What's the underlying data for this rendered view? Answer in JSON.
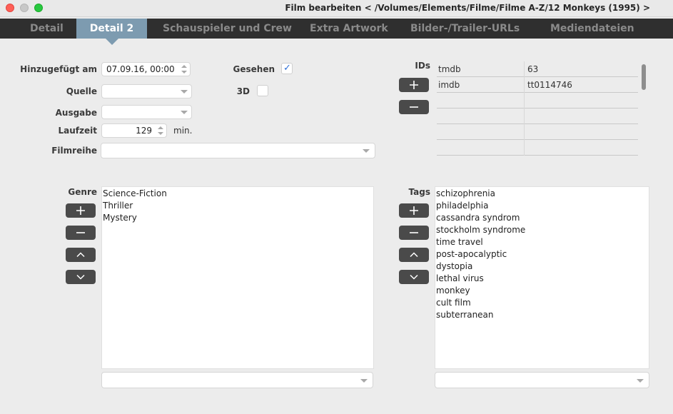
{
  "window": {
    "title": "Film bearbeiten  < /Volumes/Elements/Filme/Filme A-Z/12 Monkeys (1995) >"
  },
  "tabs": [
    {
      "label": "Detail",
      "active": false
    },
    {
      "label": "Detail 2",
      "active": true
    },
    {
      "label": "Schauspieler und Crew",
      "active": false
    },
    {
      "label": "Extra Artwork",
      "active": false
    },
    {
      "label": "Bilder-/Trailer-URLs",
      "active": false
    },
    {
      "label": "Mediendateien",
      "active": false
    }
  ],
  "form": {
    "added_label": "Hinzugefügt am",
    "added_value": "07.09.16, 00:00",
    "source_label": "Quelle",
    "source_value": "",
    "edition_label": "Ausgabe",
    "edition_value": "",
    "runtime_label": "Laufzeit",
    "runtime_value": "129",
    "runtime_unit": "min.",
    "series_label": "Filmreihe",
    "series_value": "",
    "watched_label": "Gesehen",
    "watched_checked": true,
    "threed_label": "3D",
    "threed_checked": false
  },
  "ids": {
    "label": "IDs",
    "rows": [
      {
        "provider": "tmdb",
        "value": "63"
      },
      {
        "provider": "imdb",
        "value": "tt0114746"
      },
      {
        "provider": "",
        "value": ""
      },
      {
        "provider": "",
        "value": ""
      },
      {
        "provider": "",
        "value": ""
      },
      {
        "provider": "",
        "value": ""
      }
    ]
  },
  "genre": {
    "label": "Genre",
    "items": [
      "Science-Fiction",
      "Thriller",
      "Mystery"
    ],
    "input_value": ""
  },
  "tags": {
    "label": "Tags",
    "items": [
      "schizophrenia",
      "philadelphia",
      "cassandra syndrom",
      "stockholm syndrome",
      "time travel",
      "post-apocalyptic",
      "dystopia",
      "lethal virus",
      "monkey",
      "cult film",
      "subterranean"
    ],
    "input_value": ""
  },
  "icons": {
    "add": "plus-icon",
    "remove": "minus-icon",
    "up": "chevron-up-icon",
    "down": "chevron-down-icon",
    "check": "checkmark-icon"
  },
  "colors": {
    "tab_active": "#7d9bb0",
    "tab_bar": "#2f2f2f",
    "button": "#4a4a4a",
    "check": "#2f6fd6"
  }
}
